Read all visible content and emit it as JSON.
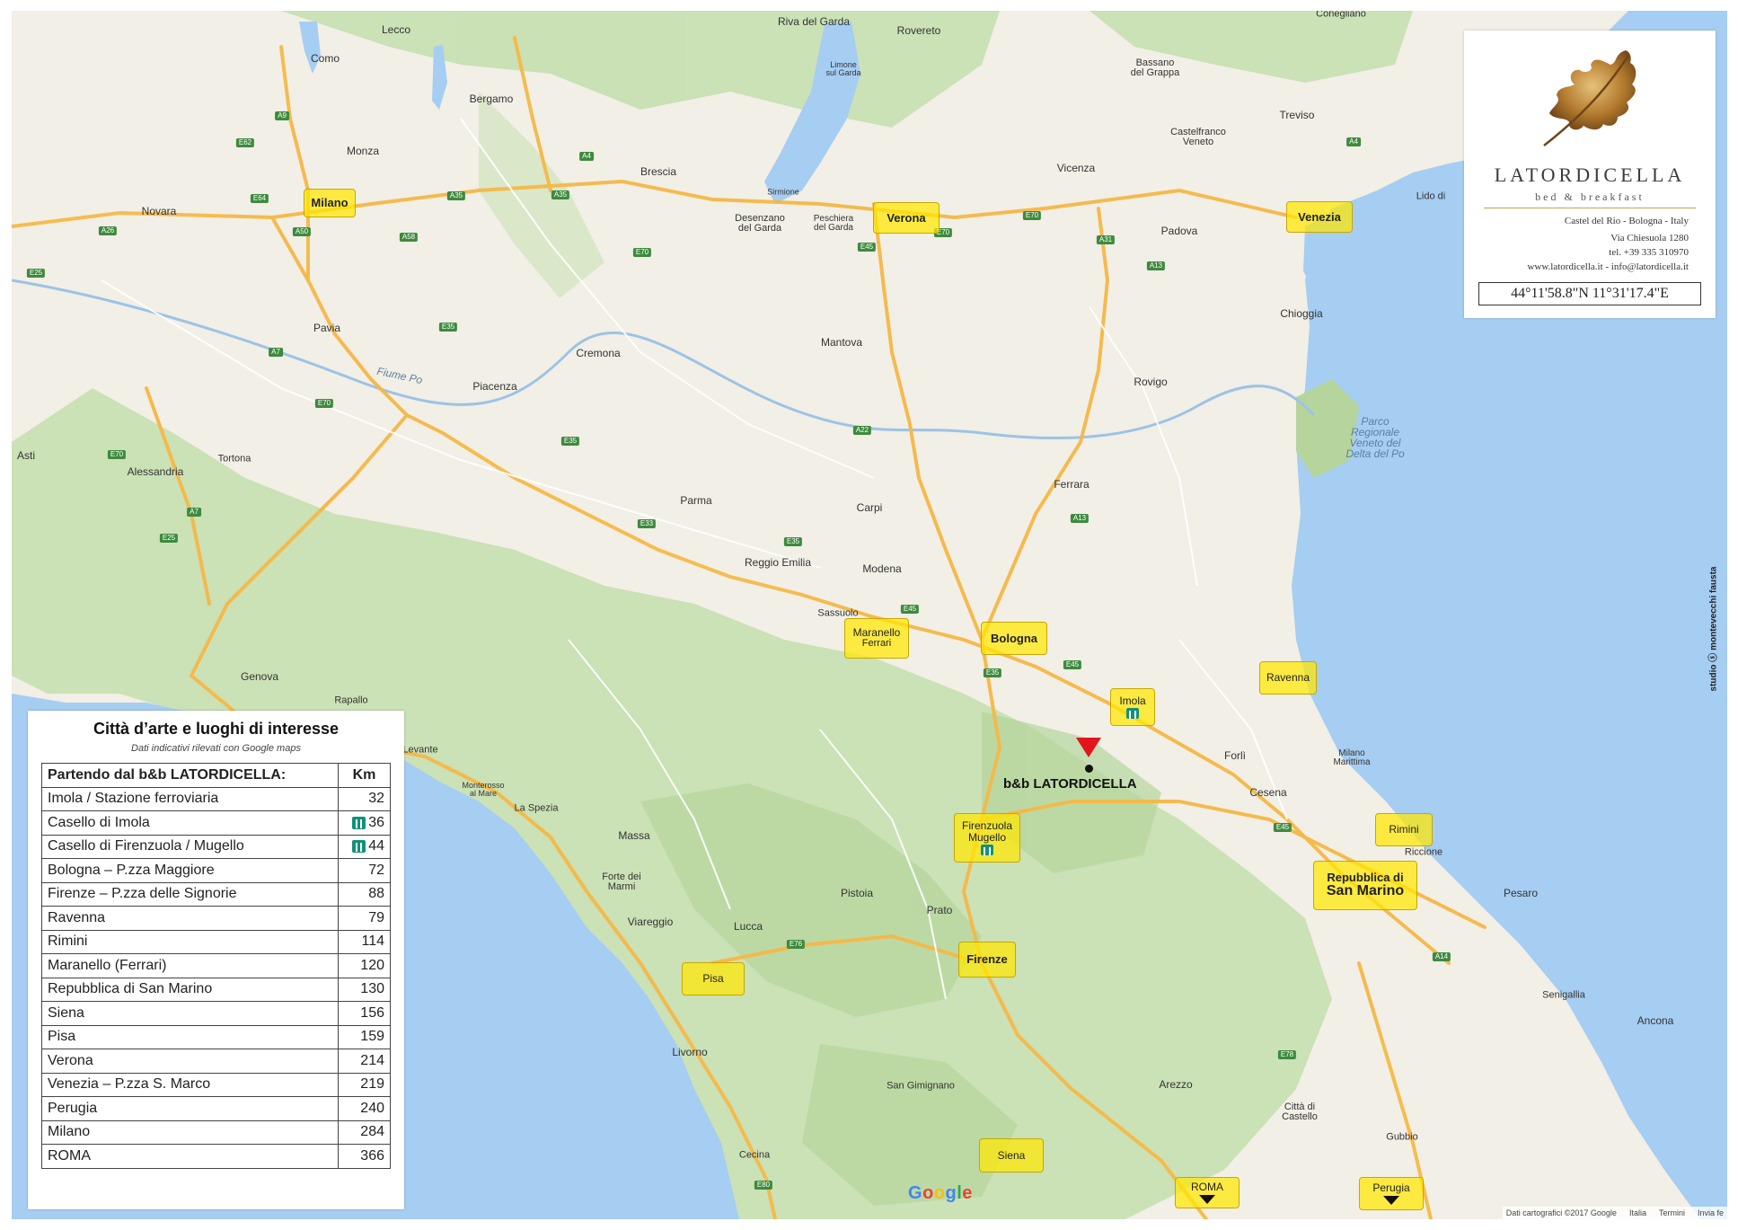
{
  "brand": {
    "name": "LATORDICELLA",
    "tagline": "bed & breakfast",
    "address": "Castel del Rio - Bologna - Italy",
    "street": "Via Chiesuola 1280",
    "phone": "tel. +39 335 310970",
    "web_email": "www.latordicella.it - info@latordicella.it",
    "coordinates": "44°11'58.8\"N 11°31'17.4\"E"
  },
  "table": {
    "title": "Città d’arte e luoghi di interesse",
    "note": "Dati indicativi rilevati con Google maps",
    "header_place": "Partendo dal b&b LATORDICELLA:",
    "header_km": "Km",
    "rows": [
      {
        "place": "Imola / Stazione ferroviaria",
        "km": "32",
        "toll": false
      },
      {
        "place": "Casello di Imola",
        "km": "36",
        "toll": true
      },
      {
        "place": "Casello di Firenzuola / Mugello",
        "km": "44",
        "toll": true
      },
      {
        "place": "Bologna – P.zza Maggiore",
        "km": "72",
        "toll": false
      },
      {
        "place": "Firenze – P.zza delle Signorie",
        "km": "88",
        "toll": false
      },
      {
        "place": "Ravenna",
        "km": "79",
        "toll": false
      },
      {
        "place": "Rimini",
        "km": "114",
        "toll": false
      },
      {
        "place": "Maranello (Ferrari)",
        "km": "120",
        "toll": false
      },
      {
        "place": "Repubblica di San Marino",
        "km": "130",
        "toll": false
      },
      {
        "place": "Siena",
        "km": "156",
        "toll": false
      },
      {
        "place": "Pisa",
        "km": "159",
        "toll": false
      },
      {
        "place": "Verona",
        "km": "214",
        "toll": false
      },
      {
        "place": "Venezia – P.zza S. Marco",
        "km": "219",
        "toll": false
      },
      {
        "place": "Perugia",
        "km": "240",
        "toll": false
      },
      {
        "place": "Milano",
        "km": "284",
        "toll": false
      },
      {
        "place": "ROMA",
        "km": "366",
        "toll": false
      }
    ]
  },
  "marker": {
    "label": "b&b LATORDICELLA",
    "color": "#e3141b"
  },
  "highlights": {
    "milano": "Milano",
    "verona": "Verona",
    "venezia": "Venezia",
    "maranello": "Maranello",
    "maranello_sub": "Ferrari",
    "bologna": "Bologna",
    "imola": "Imola",
    "ravenna": "Ravenna",
    "firenzuola": "Firenzuola",
    "mugello": "Mugello",
    "rimini": "Rimini",
    "san_marino_top": "Repubblica di",
    "san_marino_bottom": "San Marino",
    "firenze": "Firenze",
    "pisa": "Pisa",
    "siena": "Siena",
    "roma": "ROMA",
    "perugia": "Perugia"
  },
  "cities": {
    "lecco": "Lecco",
    "como": "Como",
    "bergamo": "Bergamo",
    "monza": "Monza",
    "novara": "Novara",
    "brescia": "Brescia",
    "riva": "Riva del Garda",
    "rovereto": "Rovereto",
    "limone": "Limone\nsul Garda",
    "sirmione": "Sirmione",
    "desenzano": "Desenzano\ndel Garda",
    "peschiera": "Peschiera\ndel Garda",
    "bassano": "Bassano\ndel Grappa",
    "conegliano": "Conegliano",
    "treviso": "Treviso",
    "castelfranco": "Castelfranco\nVeneto",
    "vicenza": "Vicenza",
    "padova": "Padova",
    "lido": "Lido di",
    "chioggia": "Chioggia",
    "pavia": "Pavia",
    "cremona": "Cremona",
    "mantova": "Mantova",
    "piacenza": "Piacenza",
    "rovigo": "Rovigo",
    "asti": "Asti",
    "alessandria": "Alessandria",
    "tortona": "Tortona",
    "parma": "Parma",
    "carpi": "Carpi",
    "ferrara": "Ferrara",
    "reggio": "Reggio Emilia",
    "modena": "Modena",
    "sassuolo": "Sassuolo",
    "genova": "Genova",
    "rapallo": "Rapallo",
    "levante": "Levante",
    "monterosso": "Monterosso\nal Mare",
    "la_spezia": "La Spezia",
    "forli": "Forlì",
    "cesena": "Cesena",
    "milano_marittima": "Milano\nMarittima",
    "riccione": "Riccione",
    "massa": "Massa",
    "forte_dei_marmi": "Forte dei\nMarmi",
    "viareggio": "Viareggio",
    "pistoia": "Pistoia",
    "prato": "Prato",
    "lucca": "Lucca",
    "pesaro": "Pesaro",
    "senigallia": "Senigallia",
    "ancona": "Ancona",
    "livorno": "Livorno",
    "san_gimignano": "San Gimignano",
    "arezzo": "Arezzo",
    "citta_di_castello": "Città di\nCastello",
    "gubbio": "Gubbio",
    "cecina": "Cecina",
    "parco_delta": "Parco\nRegionale\nVeneto del\nDelta del Po",
    "fiume_po": "Fiume Po"
  },
  "roads": {
    "a9": "A9",
    "e62": "E62",
    "e64": "E64",
    "a26": "A26",
    "a50": "A50",
    "a58": "A58",
    "e25": "E25",
    "a4": "A4",
    "a35": "A35",
    "a35b": "A35",
    "e35": "E35",
    "a7": "A7",
    "e70": "E70",
    "e70b": "E70",
    "e70c": "E70",
    "e70d": "E70",
    "e45": "E45",
    "a22": "A22",
    "a31": "A31",
    "a13": "A13",
    "a13b": "A13",
    "e33": "E33",
    "e35b": "E35",
    "e35c": "E35",
    "e45b": "E45",
    "e45c": "E45",
    "e45d": "E45",
    "e76": "E76",
    "a14": "A14",
    "e78": "E78",
    "e80": "E80",
    "e35d": "E35",
    "a7b": "A7",
    "e25b": "E25",
    "a4b": "A4",
    "e70e": "E70"
  },
  "map_credits": {
    "google": [
      "G",
      "o",
      "o",
      "g",
      "l",
      "e"
    ],
    "attribution": "Dati cartografici ©2017 Google",
    "italia": "Italia",
    "termini": "Termini",
    "invia": "Invia fe"
  },
  "studio_credit": "studio ⓢ montevecchi fausta",
  "colors": {
    "sea": "#a6cdf2",
    "land": "#f2efe6",
    "green": "#c6dfb0",
    "highway": "#f6b846",
    "highlight": "#ffe800"
  }
}
